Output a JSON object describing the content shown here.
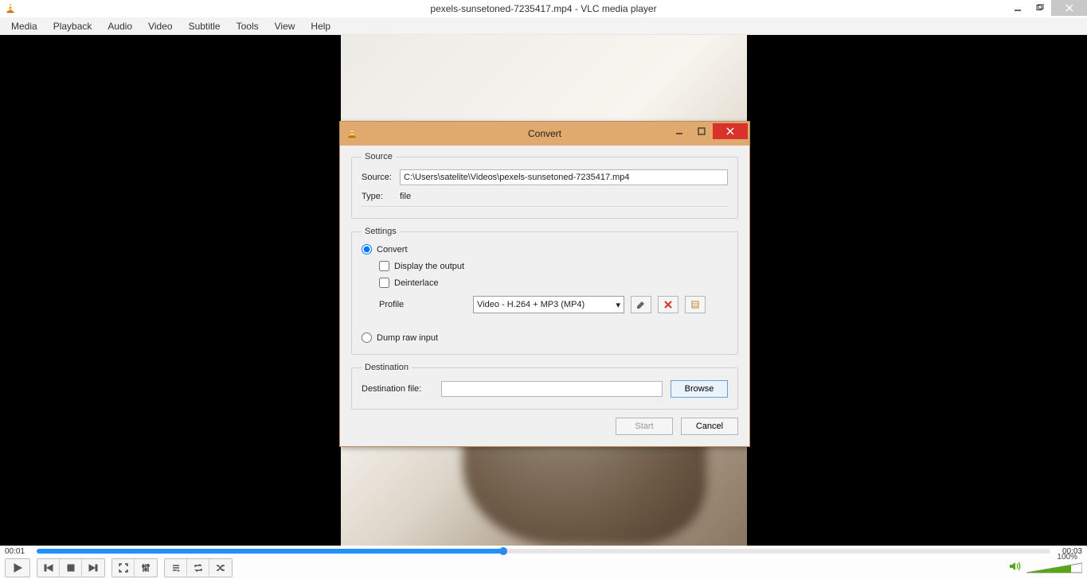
{
  "window": {
    "title": "pexels-sunsetoned-7235417.mp4 - VLC media player"
  },
  "menu": {
    "items": [
      "Media",
      "Playback",
      "Audio",
      "Video",
      "Subtitle",
      "Tools",
      "View",
      "Help"
    ]
  },
  "playback": {
    "current_time": "00:01",
    "total_time": "00:03",
    "progress_pct": 46,
    "volume_pct": "100%"
  },
  "dialog": {
    "title": "Convert",
    "source_group": "Source",
    "source_label": "Source:",
    "source_value": "C:\\Users\\satelite\\Videos\\pexels-sunsetoned-7235417.mp4",
    "type_label": "Type:",
    "type_value": "file",
    "settings_group": "Settings",
    "convert_label": "Convert",
    "display_output_label": "Display the output",
    "deinterlace_label": "Deinterlace",
    "profile_label": "Profile",
    "profile_value": "Video - H.264 + MP3 (MP4)",
    "dump_label": "Dump raw input",
    "destination_group": "Destination",
    "destination_label": "Destination file:",
    "destination_value": "",
    "browse_label": "Browse",
    "start_label": "Start",
    "cancel_label": "Cancel"
  }
}
